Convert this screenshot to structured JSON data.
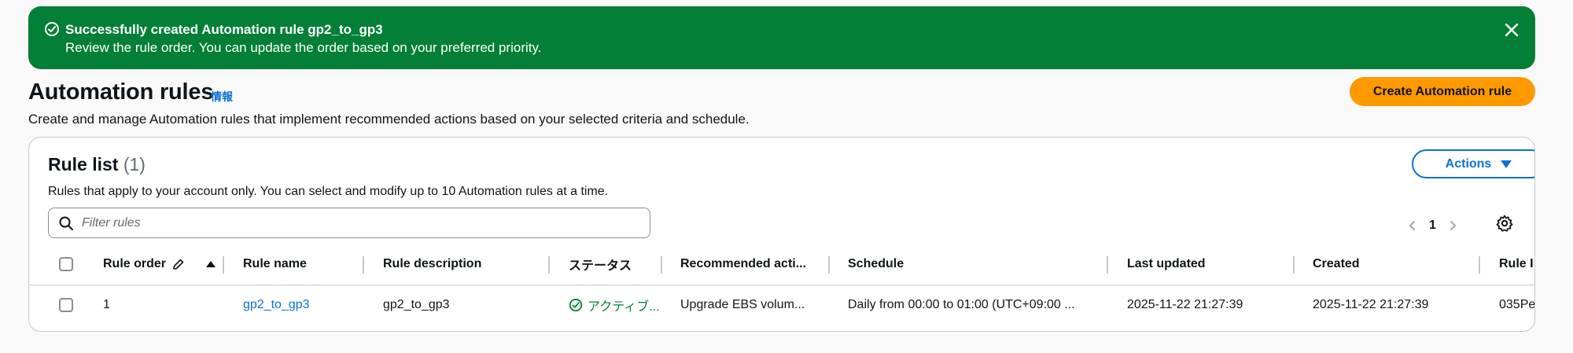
{
  "flash": {
    "title": "Successfully created Automation rule gp2_to_gp3",
    "message": "Review the rule order. You can update the order based on your preferred priority.",
    "icon": "success-check-icon",
    "close_icon": "close-icon",
    "color": "#037f38"
  },
  "header": {
    "title": "Automation rules",
    "info": "情報",
    "description": "Create and manage Automation rules that implement recommended actions based on your selected criteria and schedule.",
    "create_button": "Create Automation rule",
    "accent": "#ff9900"
  },
  "rule_list": {
    "title": "Rule list",
    "count": "(1)",
    "description": "Rules that apply to your account only. You can select and modify up to 10 Automation rules at a time.",
    "actions_button": "Actions",
    "filter_placeholder": "Filter rules",
    "page": "1",
    "columns": {
      "rule_order": "Rule order",
      "rule_name": "Rule name",
      "rule_description": "Rule description",
      "status": "ステータス",
      "recommended_actions": "Recommended acti...",
      "schedule": "Schedule",
      "last_updated": "Last updated",
      "created": "Created",
      "rule_id": "Rule I"
    },
    "rows": [
      {
        "rule_order": "1",
        "rule_name": "gp2_to_gp3",
        "rule_description": "gp2_to_gp3",
        "status": "アクティブ...",
        "recommended_actions": "Upgrade EBS volum...",
        "schedule": "Daily from 00:00 to 01:00 (UTC+09:00 ...",
        "last_updated": "2025-11-22 21:27:39",
        "created": "2025-11-22 21:27:39",
        "rule_id": "035Pe"
      }
    ]
  },
  "colors": {
    "link": "#0972d3",
    "success": "#037f38"
  }
}
